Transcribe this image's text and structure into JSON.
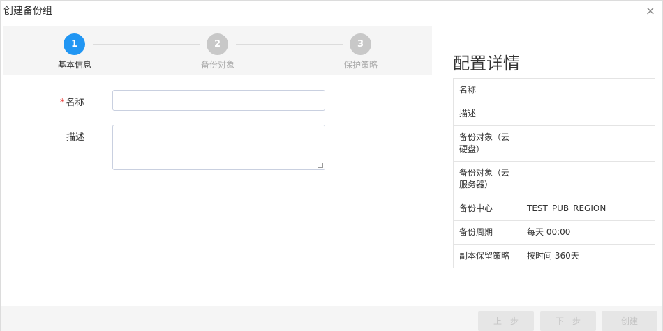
{
  "dialog": {
    "title": "创建备份组",
    "close": "×"
  },
  "steps": [
    {
      "number": "1",
      "label": "基本信息",
      "state": "active"
    },
    {
      "number": "2",
      "label": "备份对象",
      "state": "inactive"
    },
    {
      "number": "3",
      "label": "保护策略",
      "state": "inactive"
    }
  ],
  "form": {
    "required_mark": "*",
    "name_label": "名称",
    "name_value": "",
    "description_label": "描述",
    "description_value": ""
  },
  "details": {
    "title": "配置详情",
    "rows": [
      {
        "key": "名称",
        "value": ""
      },
      {
        "key": "描述",
        "value": ""
      },
      {
        "key": "备份对象（云硬盘）",
        "value": ""
      },
      {
        "key": "备份对象（云服务器）",
        "value": ""
      },
      {
        "key": "备份中心",
        "value": "TEST_PUB_REGION"
      },
      {
        "key": "备份周期",
        "value": "每天 00:00"
      },
      {
        "key": "副本保留策略",
        "value": "按时间 360天"
      }
    ]
  },
  "footer": {
    "prev_label": "上一步",
    "next_label": "下一步",
    "create_label": "创建"
  },
  "colors": {
    "accent": "#2196f3",
    "inactive_step": "#c8c8c8",
    "required": "#e53935"
  }
}
